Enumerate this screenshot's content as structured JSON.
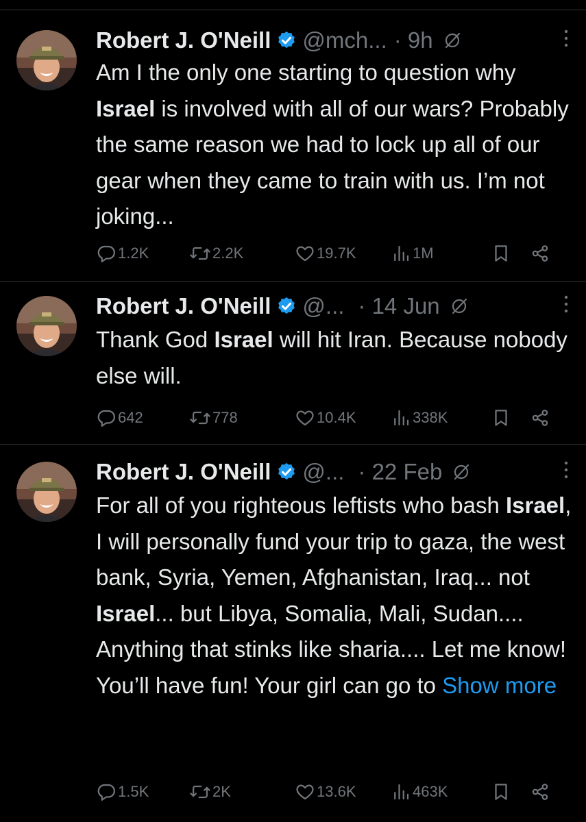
{
  "tweets": [
    {
      "name": "Robert J. O'Neill",
      "handle": "@mch...",
      "time": "· 9h",
      "body": [
        {
          "text": "Am I the only one starting to question why "
        },
        {
          "text": "Israel",
          "bold": true
        },
        {
          "text": " is involved with all of our wars? Probably the same reason we had to lock up all of our gear when they came to train with us. I’m not joking..."
        }
      ],
      "show_more": "",
      "replies": "1.2K",
      "reposts": "2.2K",
      "likes": "19.7K",
      "views": "1M"
    },
    {
      "name": "Robert J. O'Neill",
      "handle": "@...",
      "time": "· 14 Jun",
      "body": [
        {
          "text": "Thank God "
        },
        {
          "text": "Israel",
          "bold": true
        },
        {
          "text": " will hit Iran. Because nobody else will."
        }
      ],
      "show_more": "",
      "replies": "642",
      "reposts": "778",
      "likes": "10.4K",
      "views": "338K"
    },
    {
      "name": "Robert J. O'Neill",
      "handle": "@...",
      "time": "· 22 Feb",
      "body": [
        {
          "text": "For all of you righteous leftists who bash "
        },
        {
          "text": "Israel",
          "bold": true
        },
        {
          "text": ", I will personally fund your trip to gaza, the west bank, Syria, Yemen, Afghanistan, Iraq... not "
        },
        {
          "text": "Israel",
          "bold": true
        },
        {
          "text": "... but Libya, Somalia, Mali, Sudan.... Anything that stinks like sharia.... Let me know! You’ll have fun! Your girl can go to "
        }
      ],
      "show_more": "Show more",
      "replies": "1.5K",
      "reposts": "2K",
      "likes": "13.6K",
      "views": "463K"
    }
  ],
  "icons": {
    "verified": "verified-badge-icon",
    "grok": "grok-icon",
    "more": "more-icon",
    "reply": "reply-icon",
    "repost": "repost-icon",
    "like": "like-icon",
    "views": "views-icon",
    "bookmark": "bookmark-icon",
    "share": "share-icon"
  },
  "colors": {
    "accent": "#1d9bf0",
    "muted": "#71767b",
    "text": "#e7e9ea",
    "background": "#000000"
  }
}
